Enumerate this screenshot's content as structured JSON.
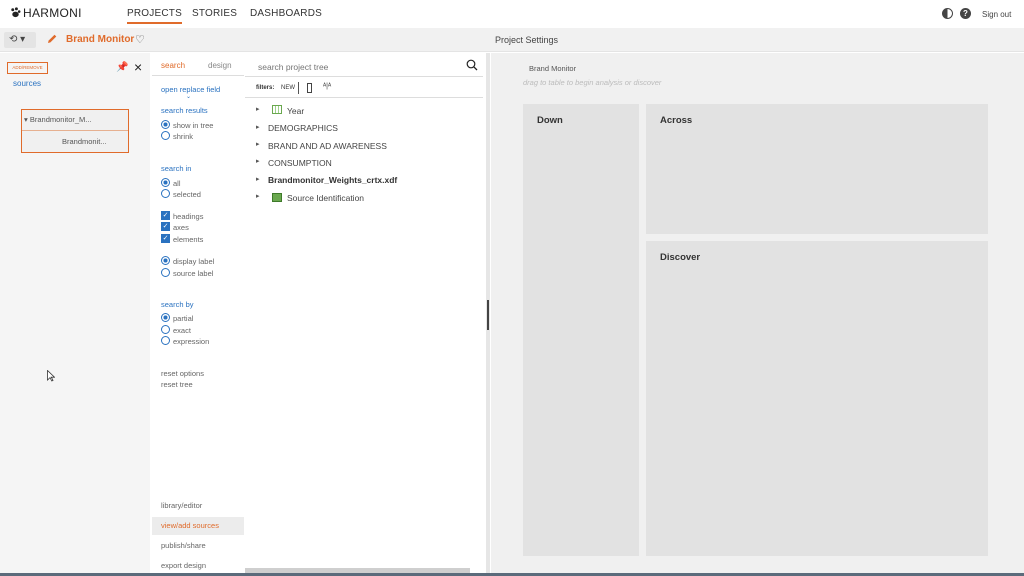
{
  "app": {
    "logo": "HARMONI"
  },
  "nav": {
    "tabs": [
      {
        "label": "PROJECTS",
        "active": true
      },
      {
        "label": "STORIES",
        "active": false
      },
      {
        "label": "DASHBOARDS",
        "active": false
      }
    ],
    "signout": "Sign out",
    "help": "?"
  },
  "subbar": {
    "history": "⟲ ▾",
    "project_name": "Brand Monitor",
    "heart": "♡",
    "section_title": "Project Settings"
  },
  "sources_panel": {
    "add_remove": "ADD/REMOVE",
    "sources_link": "sources",
    "card_title": "▾  Brandmonitor_M...",
    "card_sub": "Brandmonit..."
  },
  "options_panel": {
    "tabs": {
      "search": "search",
      "design": "design"
    },
    "open_replace": "open replace field",
    "search_results": {
      "heading": "search results",
      "options": [
        "show in tree",
        "shrink"
      ]
    },
    "search_in": {
      "heading": "search in",
      "options": [
        "all",
        "selected"
      ]
    },
    "checks": [
      "headings",
      "axes",
      "elements"
    ],
    "labels": [
      "display label",
      "source label"
    ],
    "search_by": {
      "heading": "search by",
      "options": [
        "partial",
        "exact",
        "expression"
      ]
    },
    "reset_options": "reset options",
    "reset_tree": "reset tree",
    "bottom_links": [
      "library/editor",
      "view/add sources",
      "publish/share",
      "export design"
    ]
  },
  "tree": {
    "placeholder": "search project tree",
    "filters_label": "filters:",
    "filter_new": "NEW",
    "sort": "ᴬ|ᴬ",
    "items": [
      {
        "label": "Year",
        "icon": "table-icon"
      },
      {
        "label": "DEMOGRAPHICS"
      },
      {
        "label": "BRAND AND AD AWARENESS"
      },
      {
        "label": "CONSUMPTION"
      },
      {
        "label": "Brandmonitor_Weights_crtx.xdf",
        "bold": true
      },
      {
        "label": "Source Identification",
        "icon": "source-id-icon"
      }
    ]
  },
  "settings": {
    "project_label": "Brand Monitor",
    "drag_hint": "drag to table to begin analysis or discover",
    "down": "Down",
    "across": "Across",
    "discover": "Discover"
  },
  "colors": {
    "accent": "#e06b2b",
    "link": "#2a72c0",
    "panel_bg": "#f0f0f0",
    "drop_bg": "#e2e2e2"
  }
}
